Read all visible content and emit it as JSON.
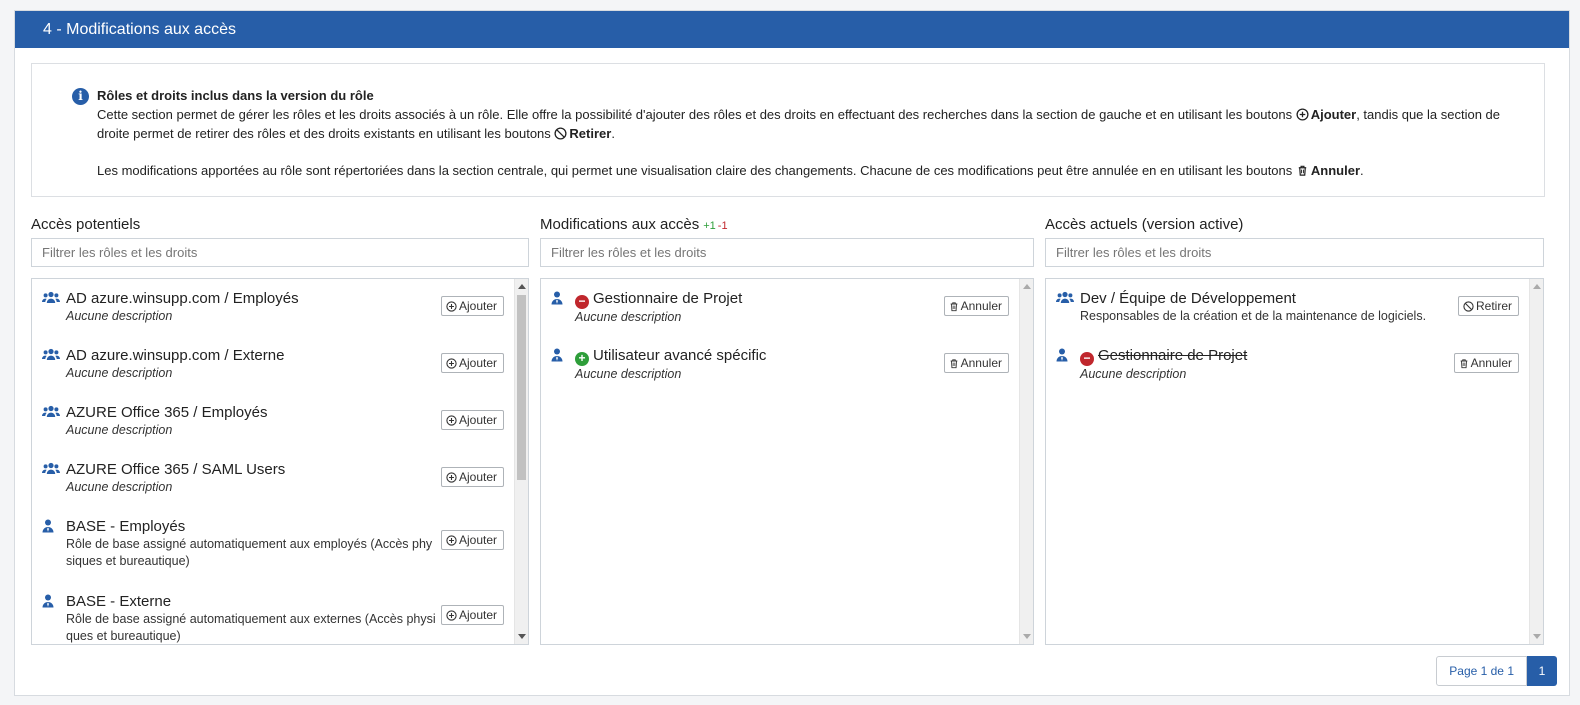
{
  "header": {
    "title": "4 - Modifications aux accès"
  },
  "info": {
    "title": "Rôles et droits inclus dans la version du rôle",
    "p1_a": "Cette section permet de gérer les rôles et les droits associés à un rôle. Elle offre la possibilité d'ajouter des rôles et des droits en effectuant des recherches dans la section de gauche et en utilisant les boutons ",
    "p1_add": "Ajouter",
    "p1_b": ", tandis que la section de droite permet de retirer des rôles et des droits existants en utilisant les boutons ",
    "p1_remove": "Retirer",
    "p1_c": ".",
    "p2_a": "Les modifications apportées au rôle sont répertoriées dans la section centrale, qui permet une visualisation claire des changements. Chacune de ces modifications peut être annulée en en utilisant les boutons ",
    "p2_cancel": "Annuler",
    "p2_b": "."
  },
  "potential": {
    "title": "Accès potentiels",
    "filter_placeholder": "Filtrer les rôles et les droits",
    "button_label": "Ajouter",
    "items": [
      {
        "name": "AD azure.winsupp.com / Employés",
        "desc": "Aucune description"
      },
      {
        "name": "AD azure.winsupp.com / Externe",
        "desc": "Aucune description"
      },
      {
        "name": "AZURE Office 365 / Employés",
        "desc": "Aucune description"
      },
      {
        "name": "AZURE Office 365 / SAML Users",
        "desc": "Aucune description"
      },
      {
        "name": "BASE - Employés",
        "desc": "Rôle de base assigné automatiquement aux employés (Accès phy siques et bureautique)"
      },
      {
        "name": "BASE - Externe",
        "desc": "Rôle de base assigné automatiquement aux externes (Accès physi ques et bureautique)"
      }
    ]
  },
  "changes": {
    "title": "Modifications aux accès",
    "plus": "+1",
    "minus": "-1",
    "filter_placeholder": "Filtrer les rôles et les droits",
    "button_label": "Annuler",
    "items": [
      {
        "name": "Gestionnaire de Projet",
        "desc": "Aucune description",
        "status": "removed"
      },
      {
        "name": "Utilisateur avancé spécific",
        "desc": "Aucune description",
        "status": "added"
      }
    ]
  },
  "current": {
    "title": "Accès actuels (version active)",
    "filter_placeholder": "Filtrer les rôles et les droits",
    "items": [
      {
        "name": "Dev / Équipe de Développement",
        "desc": "Responsables de la création et de la maintenance de logiciels.",
        "button_label": "Retirer"
      },
      {
        "name": "Gestionnaire de Projet",
        "desc": "Aucune description",
        "button_label": "Annuler",
        "status": "removed"
      }
    ]
  },
  "pagination": {
    "info": "Page 1 de 1",
    "current": "1"
  },
  "colors": {
    "primary": "#275ea8",
    "added": "#2e9e3a",
    "removed": "#c0272d"
  }
}
